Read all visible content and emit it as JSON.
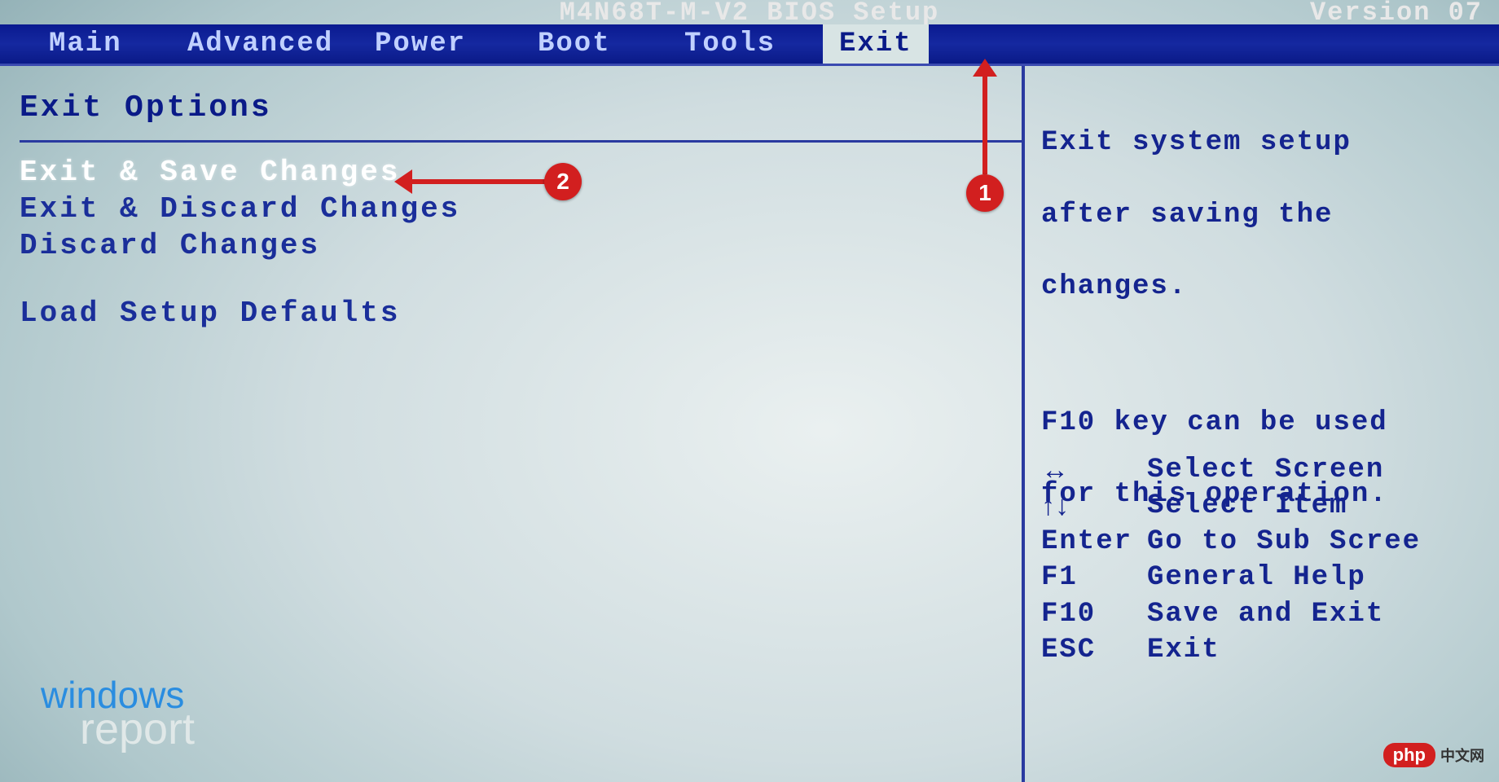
{
  "header": {
    "title": "M4N68T-M-V2 BIOS Setup",
    "version": "Version 07"
  },
  "tabs": {
    "main": "Main",
    "advanced": "Advanced",
    "power": "Power",
    "boot": "Boot",
    "tools": "Tools",
    "exit": "Exit"
  },
  "panel": {
    "title": "Exit Options",
    "items": [
      "Exit & Save Changes",
      "Exit & Discard Changes",
      "Discard Changes",
      "Load Setup Defaults"
    ]
  },
  "help": {
    "line1": "Exit system setup",
    "line2": "after saving the",
    "line3": "changes.",
    "line4": "F10 key can be used",
    "line5": "for this operation."
  },
  "legend": {
    "arrows_lr": "↔",
    "arrows_ud": "↑↓",
    "select_screen": "Select Screen",
    "select_item": "Select Item",
    "enter_key": "Enter",
    "enter_desc": "Go to Sub Scree",
    "f1_key": "F1",
    "f1_desc": "General Help",
    "f10_key": "F10",
    "f10_desc": "Save and Exit",
    "esc_key": "ESC",
    "esc_desc": "Exit"
  },
  "annotations": {
    "n1": "1",
    "n2": "2"
  },
  "watermark": {
    "windows": "windows",
    "report": "report",
    "php": "php",
    "php_cn": "中文网"
  }
}
